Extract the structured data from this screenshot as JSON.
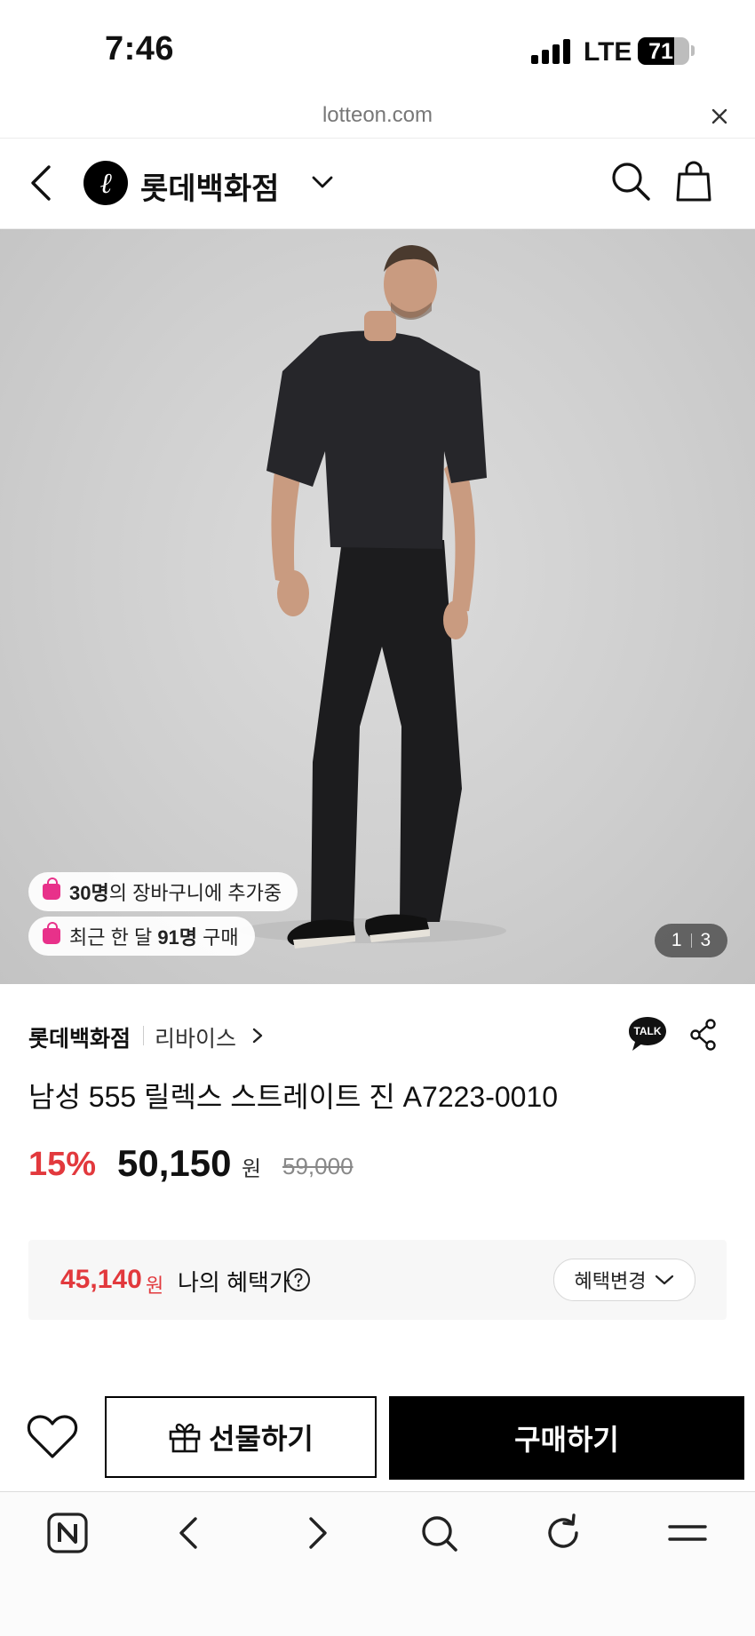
{
  "status_bar": {
    "time": "7:46",
    "network": "LTE",
    "battery": "71",
    "battery_level_pct": 71
  },
  "browser": {
    "url": "lotteon.com",
    "close_icon": "close-icon"
  },
  "header": {
    "back_icon": "chevron-left-icon",
    "store_logo": "lotte-logo-icon",
    "logo_glyph": "ℓ",
    "store_name": "롯데백화점",
    "dropdown_icon": "chevron-down-icon",
    "search_icon": "search-icon",
    "cart_icon": "shopping-bag-icon"
  },
  "product_image": {
    "badges": [
      {
        "bold": "30명",
        "text": "의 장바구니에 추가중"
      },
      {
        "prefix": "최근 한 달 ",
        "bold": "91명",
        "text": " 구매"
      }
    ],
    "pager_current": "1",
    "pager_total": "3"
  },
  "product": {
    "store": "롯데백화점",
    "brand": "리바이스",
    "title": "남성 555 릴렉스 스트레이트 진 A7223-0010",
    "discount": "15%",
    "price": "50,150",
    "price_unit": "원",
    "original_price": "59,000",
    "talk_label": "TALK",
    "share_icon": "share-icon"
  },
  "benefit": {
    "price": "45,140",
    "unit": "원",
    "label": "나의 혜택가",
    "change_label": "혜택변경"
  },
  "actions": {
    "wish_icon": "heart-icon",
    "gift_label": "선물하기",
    "buy_label": "구매하기"
  },
  "toolbar": [
    "naver-home-icon",
    "back-icon",
    "forward-icon",
    "search-icon",
    "refresh-icon",
    "menu-icon"
  ],
  "colors": {
    "accent_red": "#e2393d",
    "badge_pink": "#e8318a",
    "primary": "#000000"
  }
}
